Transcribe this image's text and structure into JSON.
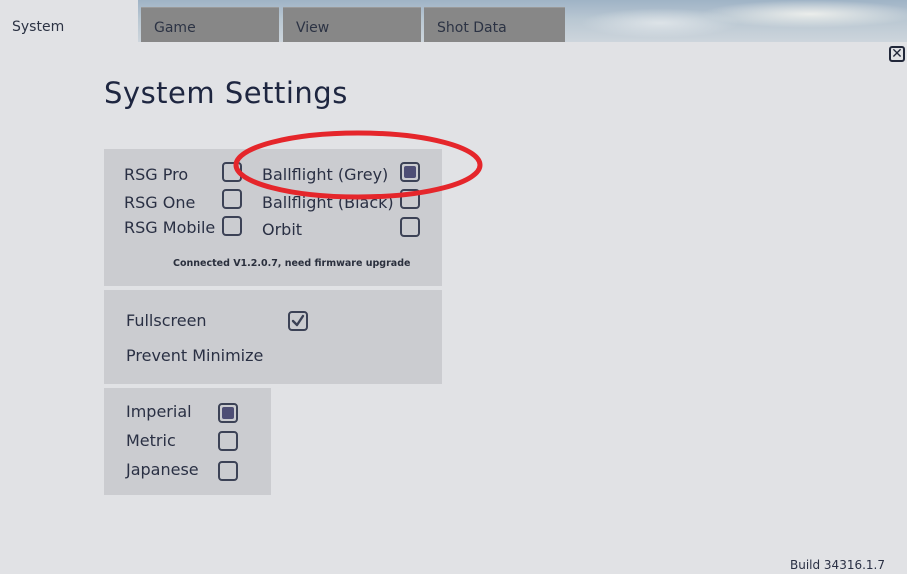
{
  "tabs": [
    {
      "label": "System",
      "active": true
    },
    {
      "label": "Game",
      "active": false
    },
    {
      "label": "View",
      "active": false
    },
    {
      "label": "Shot Data",
      "active": false
    }
  ],
  "page": {
    "title": "System Settings"
  },
  "device_panel": {
    "left_options": [
      {
        "label": "RSG Pro",
        "checked": false
      },
      {
        "label": "RSG One",
        "checked": false
      },
      {
        "label": "RSG Mobile",
        "checked": false
      }
    ],
    "right_options": [
      {
        "label": "Ballflight (Grey)",
        "checked": true
      },
      {
        "label": "Ballflight (Black)",
        "checked": false
      },
      {
        "label": "Orbit",
        "checked": false
      }
    ],
    "status": "Connected V1.2.0.7, need firmware upgrade"
  },
  "display_panel": {
    "fullscreen": {
      "label": "Fullscreen",
      "checked": true
    },
    "prevent_minimize": {
      "label": "Prevent Minimize"
    }
  },
  "units_panel": {
    "options": [
      {
        "label": "Imperial",
        "checked": true
      },
      {
        "label": "Metric",
        "checked": false
      },
      {
        "label": "Japanese",
        "checked": false
      }
    ]
  },
  "footer": {
    "build": "Build 34316.1.7"
  },
  "colors": {
    "highlight_ellipse": "#e5262b",
    "checkbox_fill": "#4e4e75"
  }
}
